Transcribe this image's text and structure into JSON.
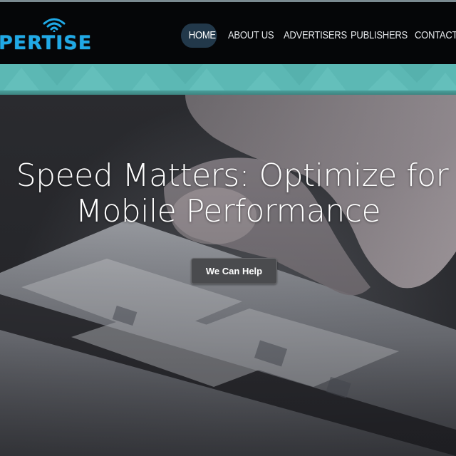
{
  "brand": {
    "logo_text": "PERTISE",
    "logo_icon": "wifi-signal-icon",
    "accent_color": "#1fa9e6"
  },
  "nav": {
    "items": [
      {
        "label": "HOME",
        "active": true
      },
      {
        "label": "ABOUT US",
        "active": false
      },
      {
        "label": "ADVERTISERS",
        "active": false
      },
      {
        "label": "PUBLISHERS",
        "active": false
      },
      {
        "label": "CONTACT US",
        "active": false
      }
    ]
  },
  "hero": {
    "headline_line1": "Speed Matters: Optimize for",
    "headline_line2": "Mobile Performance",
    "cta_label": "We Can Help"
  },
  "colors": {
    "navbar_bg": "#050608",
    "teal_band": "#5cb8b4",
    "nav_active_bg": "#22384a",
    "cta_bg": "#4a4b4e"
  }
}
